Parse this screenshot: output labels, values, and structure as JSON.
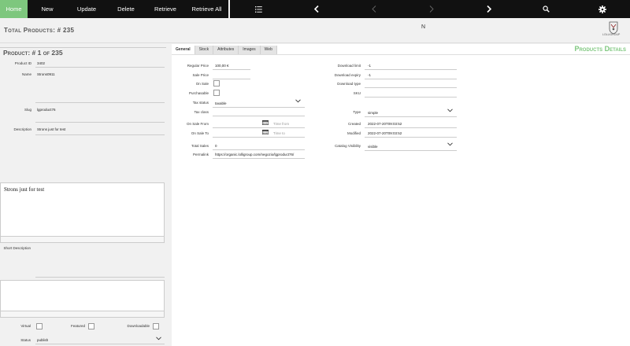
{
  "toolbar": {
    "home": "Home",
    "new": "New",
    "update": "Update",
    "delete": "Delete",
    "retrieve": "Retrieve",
    "retrieve_all": "Retrieve All"
  },
  "header": {
    "total_products": "Total Products: # 235",
    "center_letter": "N",
    "logo_text": "LOLLIGROUP"
  },
  "product": {
    "title": "Product: # 1 of 235",
    "product_id_label": "Product ID",
    "product_id": "3402",
    "name_label": "Name",
    "name": "Strons0911",
    "slug_label": "Slug",
    "slug": "lgproduct76",
    "description_label": "Description",
    "description": "Strons just for test",
    "description_body": "Strons just for test",
    "short_description_label": "Short Description",
    "virtual_label": "Virtual",
    "featured_label": "Featured",
    "downloadable_label": "Downloadable",
    "status_label": "Status",
    "status": "publish"
  },
  "tabs": [
    "General",
    "Stock",
    "Attributes",
    "Images",
    "Web"
  ],
  "details": {
    "title": "Products Details",
    "regular_price_label": "Regular Price",
    "regular_price": "100,00 €",
    "sale_price_label": "Sale Price",
    "on_sale_label": "On Sale",
    "purchasable_label": "Purchasable",
    "tax_status_label": "Tax status",
    "tax_status": "taxable",
    "tax_class_label": "Tax class",
    "on_sale_from_label": "On Sale From",
    "on_sale_from_placeholder": "Time from",
    "on_sale_to_label": "On Sale To",
    "on_sale_to_placeholder": "Time to",
    "total_sales_label": "Total Sales",
    "total_sales": "0",
    "permalink_label": "Permalink",
    "permalink": "https://organic.lolligroup.com/negozio/lgproduct76/",
    "download_limit_label": "Download limit",
    "download_limit": "-1",
    "download_expiry_label": "Download expiry",
    "download_expiry": "-1",
    "download_type_label": "Download type",
    "sku_label": "SKU",
    "type_label": "Type",
    "type": "simple",
    "created_label": "Created",
    "created": "2022-07-20T09:03:52",
    "modified_label": "Modified",
    "modified": "2022-07-20T09:03:52",
    "catalog_visibility_label": "Catalog Visibility",
    "catalog_visibility": "visible"
  }
}
